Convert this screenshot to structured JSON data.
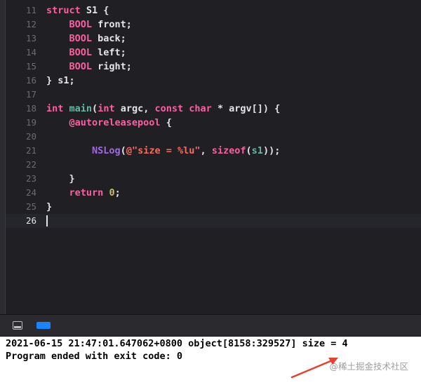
{
  "editor": {
    "lines": [
      {
        "num": "11",
        "tokens": [
          {
            "t": "struct",
            "c": "kw"
          },
          {
            "t": " S1 {",
            "c": "plain"
          }
        ]
      },
      {
        "num": "12",
        "tokens": [
          {
            "t": "    ",
            "c": "plain"
          },
          {
            "t": "BOOL",
            "c": "kw"
          },
          {
            "t": " front;",
            "c": "plain"
          }
        ]
      },
      {
        "num": "13",
        "tokens": [
          {
            "t": "    ",
            "c": "plain"
          },
          {
            "t": "BOOL",
            "c": "kw"
          },
          {
            "t": " back;",
            "c": "plain"
          }
        ]
      },
      {
        "num": "14",
        "tokens": [
          {
            "t": "    ",
            "c": "plain"
          },
          {
            "t": "BOOL",
            "c": "kw"
          },
          {
            "t": " left;",
            "c": "plain"
          }
        ]
      },
      {
        "num": "15",
        "tokens": [
          {
            "t": "    ",
            "c": "plain"
          },
          {
            "t": "BOOL",
            "c": "kw"
          },
          {
            "t": " right;",
            "c": "plain"
          }
        ]
      },
      {
        "num": "16",
        "tokens": [
          {
            "t": "} s1;",
            "c": "plain"
          }
        ]
      },
      {
        "num": "17",
        "tokens": []
      },
      {
        "num": "18",
        "tokens": [
          {
            "t": "int",
            "c": "kw"
          },
          {
            "t": " ",
            "c": "plain"
          },
          {
            "t": "main",
            "c": "fn"
          },
          {
            "t": "(",
            "c": "plain"
          },
          {
            "t": "int",
            "c": "kw"
          },
          {
            "t": " argc, ",
            "c": "plain"
          },
          {
            "t": "const",
            "c": "kw"
          },
          {
            "t": " ",
            "c": "plain"
          },
          {
            "t": "char",
            "c": "kw"
          },
          {
            "t": " * argv[]) {",
            "c": "plain"
          }
        ]
      },
      {
        "num": "19",
        "tokens": [
          {
            "t": "    ",
            "c": "plain"
          },
          {
            "t": "@autoreleasepool",
            "c": "kw"
          },
          {
            "t": " {",
            "c": "plain"
          }
        ]
      },
      {
        "num": "20",
        "tokens": []
      },
      {
        "num": "21",
        "tokens": [
          {
            "t": "        ",
            "c": "plain"
          },
          {
            "t": "NSLog",
            "c": "ty"
          },
          {
            "t": "(",
            "c": "plain"
          },
          {
            "t": "@\"size = %lu\"",
            "c": "str"
          },
          {
            "t": ", ",
            "c": "plain"
          },
          {
            "t": "sizeof",
            "c": "kw"
          },
          {
            "t": "(",
            "c": "plain"
          },
          {
            "t": "s1",
            "c": "fn"
          },
          {
            "t": "));",
            "c": "plain"
          }
        ]
      },
      {
        "num": "22",
        "tokens": []
      },
      {
        "num": "23",
        "tokens": [
          {
            "t": "    }",
            "c": "plain"
          }
        ]
      },
      {
        "num": "24",
        "tokens": [
          {
            "t": "    ",
            "c": "plain"
          },
          {
            "t": "return",
            "c": "kw"
          },
          {
            "t": " ",
            "c": "plain"
          },
          {
            "t": "0",
            "c": "num"
          },
          {
            "t": ";",
            "c": "plain"
          }
        ]
      },
      {
        "num": "25",
        "tokens": [
          {
            "t": "}",
            "c": "plain"
          }
        ]
      },
      {
        "num": "26",
        "tokens": [],
        "current": true
      }
    ]
  },
  "debug_bar": {
    "icons": [
      "hide-debug-area-icon",
      "breakpoints-toggle-icon"
    ]
  },
  "console": {
    "line1": "2021-06-15 21:47:01.647062+0800 object[8158:329527] size = 4",
    "line2": "Program ended with exit code: 0"
  },
  "watermark": "@稀土掘金技术社区",
  "colors": {
    "keyword": "#fc5fa3",
    "type": "#a167e6",
    "function": "#67b7a4",
    "string": "#fc6a5d",
    "number": "#d0bf69",
    "plain": "#e5e5e7",
    "arrow": "#e8402e"
  }
}
